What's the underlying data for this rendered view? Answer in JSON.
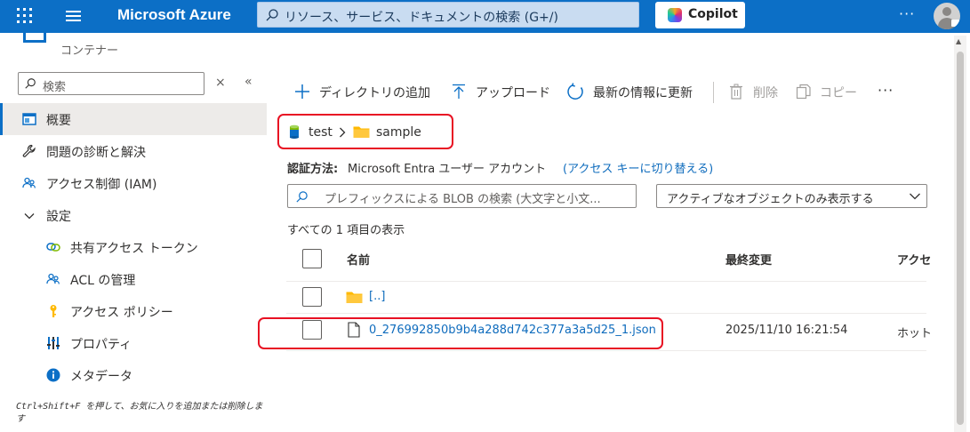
{
  "topbar": {
    "brand": "Microsoft Azure",
    "search_placeholder": "リソース、サービス、ドキュメントの検索 (G+/)",
    "copilot_label": "Copilot",
    "more_label": "···"
  },
  "sidebar": {
    "resource_type": "コンテナー",
    "search_placeholder": "検索",
    "close_label": "×",
    "collapse_label": "«",
    "items": [
      {
        "label": "概要",
        "icon": "overview-icon"
      },
      {
        "label": "問題の診断と解決",
        "icon": "wrench-icon"
      },
      {
        "label": "アクセス制御 (IAM)",
        "icon": "people-icon"
      },
      {
        "label": "設定",
        "icon": "chevron-down-icon"
      },
      {
        "label": "共有アクセス トークン",
        "icon": "link-icon"
      },
      {
        "label": "ACL の管理",
        "icon": "people-icon"
      },
      {
        "label": "アクセス ポリシー",
        "icon": "key-icon"
      },
      {
        "label": "プロパティ",
        "icon": "properties-icon"
      },
      {
        "label": "メタデータ",
        "icon": "info-icon"
      }
    ],
    "hint": "Ctrl+Shift+F を押して、お気に入りを追加または削除します"
  },
  "toolbar": {
    "add_directory": "ディレクトリの追加",
    "upload": "アップロード",
    "refresh": "最新の情報に更新",
    "delete": "削除",
    "copy": "コピー",
    "more": "···"
  },
  "breadcrumb": {
    "container": "test",
    "folder": "sample"
  },
  "auth": {
    "label": "認証方法:",
    "value": "Microsoft Entra ユーザー アカウント",
    "switch_link": "(アクセス キーに切り替える)"
  },
  "blob_search": {
    "placeholder": "プレフィックスによる BLOB の検索 (大文字と小文..."
  },
  "filter": {
    "selected": "アクティブなオブジェクトのみ表示する"
  },
  "list": {
    "count_text": "すべての 1 項目の表示",
    "columns": [
      "名前",
      "最終変更",
      "アクセ"
    ],
    "rows": [
      {
        "name": "[..]",
        "type": "folder",
        "modified": "",
        "access": ""
      },
      {
        "name": "0_276992850b9b4a288d742c377a3a5d25_1.json",
        "type": "file",
        "modified": "2025/11/10 16:21:54",
        "access": "ホット"
      }
    ]
  },
  "colors": {
    "topbar": "#0c6fc6",
    "accent": "#0f6cbd",
    "highlight_box": "#e81123",
    "folder": "#ffb900"
  }
}
